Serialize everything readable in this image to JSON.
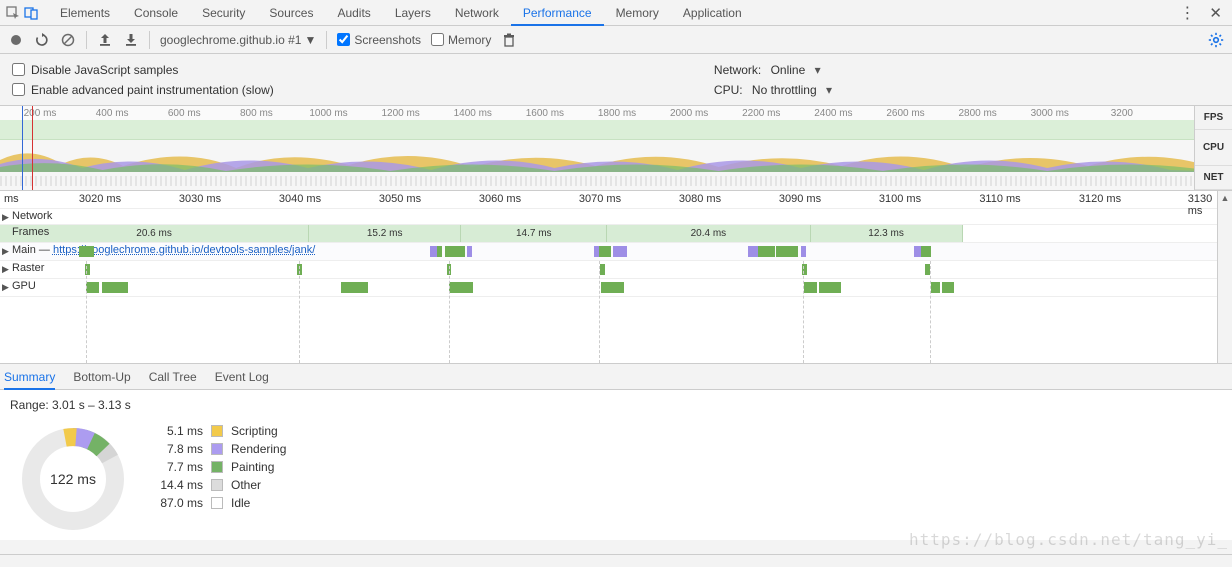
{
  "tabs": [
    "Elements",
    "Console",
    "Security",
    "Sources",
    "Audits",
    "Layers",
    "Network",
    "Performance",
    "Memory",
    "Application"
  ],
  "active_tab_index": 7,
  "toolbar": {
    "url": "googlechrome.github.io #1",
    "screenshots_label": "Screenshots",
    "screenshots_checked": true,
    "memory_label": "Memory",
    "memory_checked": false
  },
  "settings": {
    "disable_js_label": "Disable JavaScript samples",
    "disable_js_checked": false,
    "enable_paint_label": "Enable advanced paint instrumentation (slow)",
    "enable_paint_checked": false,
    "network_label": "Network:",
    "network_value": "Online",
    "cpu_label": "CPU:",
    "cpu_value": "No throttling"
  },
  "overview": {
    "ticks": [
      "200 ms",
      "400 ms",
      "600 ms",
      "800 ms",
      "1000 ms",
      "1200 ms",
      "1400 ms",
      "1600 ms",
      "1800 ms",
      "2000 ms",
      "2200 ms",
      "2400 ms",
      "2600 ms",
      "2800 ms",
      "3000 ms",
      "3200"
    ],
    "right_labels": [
      "FPS",
      "CPU",
      "NET"
    ]
  },
  "detail": {
    "ruler": [
      "ms",
      "3020 ms",
      "3030 ms",
      "3040 ms",
      "3050 ms",
      "3060 ms",
      "3070 ms",
      "3080 ms",
      "3090 ms",
      "3100 ms",
      "3110 ms",
      "3120 ms",
      "3130 ms"
    ],
    "tracks": {
      "network": "Network",
      "frames": "Frames",
      "main_prefix": "Main — ",
      "main_url": "https://googlechrome.github.io/devtools-samples/jank/",
      "raster": "Raster",
      "gpu": "GPU"
    },
    "frames": [
      {
        "left_pct": 0,
        "width_pct": 25.4,
        "label": "20.6 ms"
      },
      {
        "left_pct": 25.4,
        "width_pct": 12.5,
        "label": "15.2 ms"
      },
      {
        "left_pct": 37.9,
        "width_pct": 12.0,
        "label": "14.7 ms"
      },
      {
        "left_pct": 49.9,
        "width_pct": 16.7,
        "label": "20.4 ms"
      },
      {
        "left_pct": 66.6,
        "width_pct": 12.5,
        "label": "12.3 ms"
      }
    ],
    "main_tasks": [
      {
        "left_pct": 6.5,
        "width_pct": 1.2,
        "color": "#6fae54"
      },
      {
        "left_pct": 35.3,
        "width_pct": 0.6,
        "color": "#9e8ee6"
      },
      {
        "left_pct": 35.9,
        "width_pct": 0.4,
        "color": "#6fae54"
      },
      {
        "left_pct": 36.6,
        "width_pct": 1.6,
        "color": "#6fae54"
      },
      {
        "left_pct": 38.4,
        "width_pct": 0.4,
        "color": "#9e8ee6"
      },
      {
        "left_pct": 48.8,
        "width_pct": 0.4,
        "color": "#9e8ee6"
      },
      {
        "left_pct": 49.2,
        "width_pct": 1.0,
        "color": "#6fae54"
      },
      {
        "left_pct": 50.4,
        "width_pct": 1.1,
        "color": "#9e8ee6"
      },
      {
        "left_pct": 61.5,
        "width_pct": 0.8,
        "color": "#9e8ee6"
      },
      {
        "left_pct": 62.3,
        "width_pct": 1.4,
        "color": "#6fae54"
      },
      {
        "left_pct": 63.8,
        "width_pct": 1.8,
        "color": "#6fae54"
      },
      {
        "left_pct": 65.8,
        "width_pct": 0.4,
        "color": "#9e8ee6"
      },
      {
        "left_pct": 75.1,
        "width_pct": 0.6,
        "color": "#9e8ee6"
      },
      {
        "left_pct": 75.7,
        "width_pct": 0.8,
        "color": "#6fae54"
      }
    ],
    "raster_tasks": [
      {
        "left_pct": 7.0,
        "width_pct": 0.4,
        "color": "#6fae54"
      },
      {
        "left_pct": 24.4,
        "width_pct": 0.4,
        "color": "#6fae54"
      },
      {
        "left_pct": 36.7,
        "width_pct": 0.4,
        "color": "#6fae54"
      },
      {
        "left_pct": 49.3,
        "width_pct": 0.4,
        "color": "#6fae54"
      },
      {
        "left_pct": 65.9,
        "width_pct": 0.4,
        "color": "#6fae54"
      },
      {
        "left_pct": 76.0,
        "width_pct": 0.4,
        "color": "#6fae54"
      }
    ],
    "gpu_tasks": [
      {
        "left_pct": 7.1,
        "width_pct": 1.0,
        "color": "#6fae54"
      },
      {
        "left_pct": 8.4,
        "width_pct": 2.1,
        "color": "#6fae54"
      },
      {
        "left_pct": 28.0,
        "width_pct": 2.2,
        "color": "#6fae54"
      },
      {
        "left_pct": 36.9,
        "width_pct": 2.0,
        "color": "#6fae54"
      },
      {
        "left_pct": 49.4,
        "width_pct": 1.9,
        "color": "#6fae54"
      },
      {
        "left_pct": 66.1,
        "width_pct": 1.0,
        "color": "#6fae54"
      },
      {
        "left_pct": 67.3,
        "width_pct": 1.8,
        "color": "#6fae54"
      },
      {
        "left_pct": 76.5,
        "width_pct": 0.7,
        "color": "#6fae54"
      },
      {
        "left_pct": 77.4,
        "width_pct": 1.0,
        "color": "#6fae54"
      }
    ],
    "dash_pct": [
      7.1,
      24.6,
      36.9,
      49.2,
      66.0,
      76.4
    ]
  },
  "bottom_tabs": [
    "Summary",
    "Bottom-Up",
    "Call Tree",
    "Event Log"
  ],
  "bottom_active": 0,
  "summary": {
    "range": "Range: 3.01 s – 3.13 s",
    "total": "122 ms",
    "items": [
      {
        "ms": "5.1 ms",
        "label": "Scripting",
        "color": "#f2ca4b"
      },
      {
        "ms": "7.8 ms",
        "label": "Rendering",
        "color": "#ac9cf0"
      },
      {
        "ms": "7.7 ms",
        "label": "Painting",
        "color": "#74b266"
      },
      {
        "ms": "14.4 ms",
        "label": "Other",
        "color": "#dcdcdc"
      },
      {
        "ms": "87.0 ms",
        "label": "Idle",
        "color": "#ffffff"
      }
    ]
  },
  "watermark": "https://blog.csdn.net/tang_yi_"
}
